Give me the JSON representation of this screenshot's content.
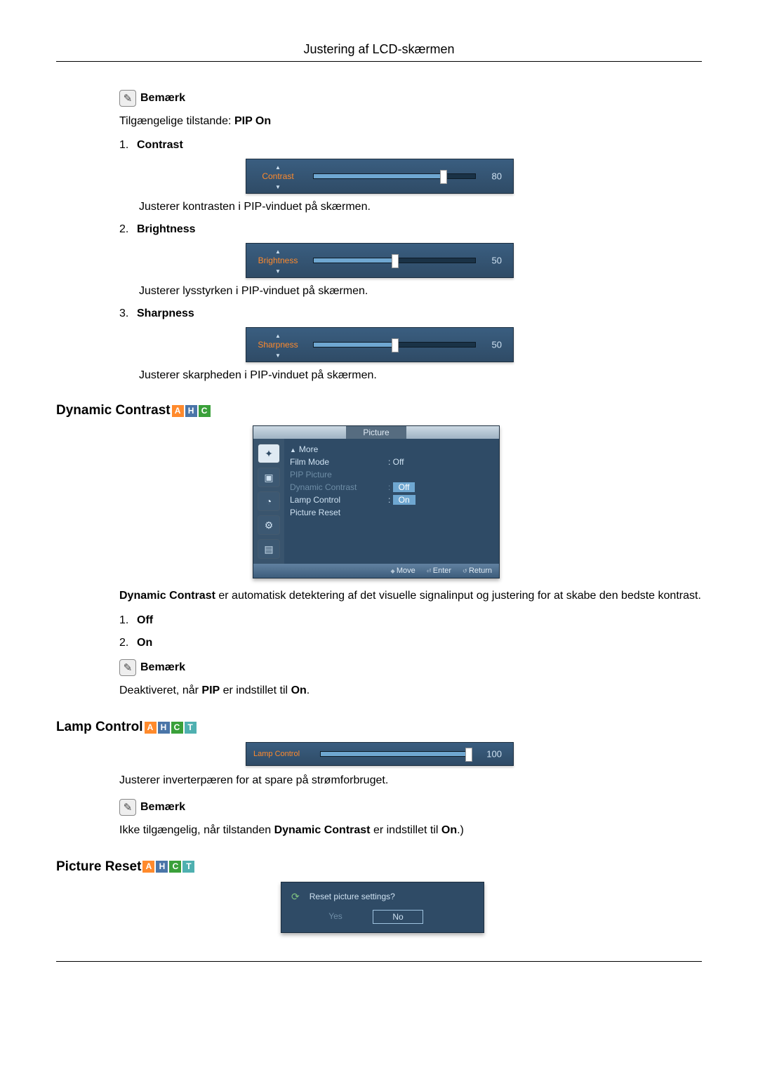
{
  "page_title": "Justering af LCD-skærmen",
  "note_label": "Bemærk",
  "intro_text_prefix": "Tilgængelige tilstande: ",
  "intro_text_bold": "PIP On",
  "items": [
    {
      "num": "1.",
      "label": "Contrast",
      "slider_label": "Contrast",
      "value": "80",
      "pct": 80,
      "desc": "Justerer kontrasten i PIP-vinduet på skærmen."
    },
    {
      "num": "2.",
      "label": "Brightness",
      "slider_label": "Brightness",
      "value": "50",
      "pct": 50,
      "desc": "Justerer lysstyrken i PIP-vinduet på skærmen."
    },
    {
      "num": "3.",
      "label": "Sharpness",
      "slider_label": "Sharpness",
      "value": "50",
      "pct": 50,
      "desc": "Justerer skarpheden i PIP-vinduet på skærmen."
    }
  ],
  "dynamic": {
    "heading": "Dynamic Contrast",
    "badges": [
      "A",
      "H",
      "C"
    ],
    "menu": {
      "header": "Picture",
      "rows": [
        {
          "k": "More",
          "v": "",
          "style": "arrow"
        },
        {
          "k": "Film Mode",
          "v": ": Off",
          "style": ""
        },
        {
          "k": "PIP Picture",
          "v": "",
          "style": "dim"
        },
        {
          "k": "Dynamic Contrast",
          "v": "Off",
          "style": "dim sel-off"
        },
        {
          "k": "Lamp Control",
          "v": "On",
          "style": "sel"
        },
        {
          "k": "Picture Reset",
          "v": "",
          "style": ""
        }
      ],
      "footer": [
        "Move",
        "Enter",
        "Return"
      ]
    },
    "desc_bold": "Dynamic Contrast",
    "desc_rest": " er automatisk detektering af det visuelle signalinput og justering for at skabe den bedste kontrast.",
    "options": [
      {
        "num": "1.",
        "label": "Off"
      },
      {
        "num": "2.",
        "label": "On"
      }
    ],
    "note_text_prefix": "Deaktiveret, når ",
    "note_text_bold": "PIP",
    "note_text_mid": " er indstillet til ",
    "note_text_bold2": "On",
    "note_text_suffix": "."
  },
  "lamp": {
    "heading": "Lamp Control",
    "badges": [
      "A",
      "H",
      "C",
      "T"
    ],
    "slider_label": "Lamp Control",
    "value": "100",
    "pct": 100,
    "desc": "Justerer inverterpæren for at spare på strømforbruget.",
    "note_prefix": "Ikke tilgængelig, når tilstanden ",
    "note_bold": "Dynamic Contrast",
    "note_mid": " er indstillet til ",
    "note_bold2": "On",
    "note_suffix": ".)"
  },
  "reset": {
    "heading": "Picture Reset",
    "badges": [
      "A",
      "H",
      "C",
      "T"
    ],
    "question": "Reset picture settings?",
    "yes": "Yes",
    "no": "No"
  }
}
